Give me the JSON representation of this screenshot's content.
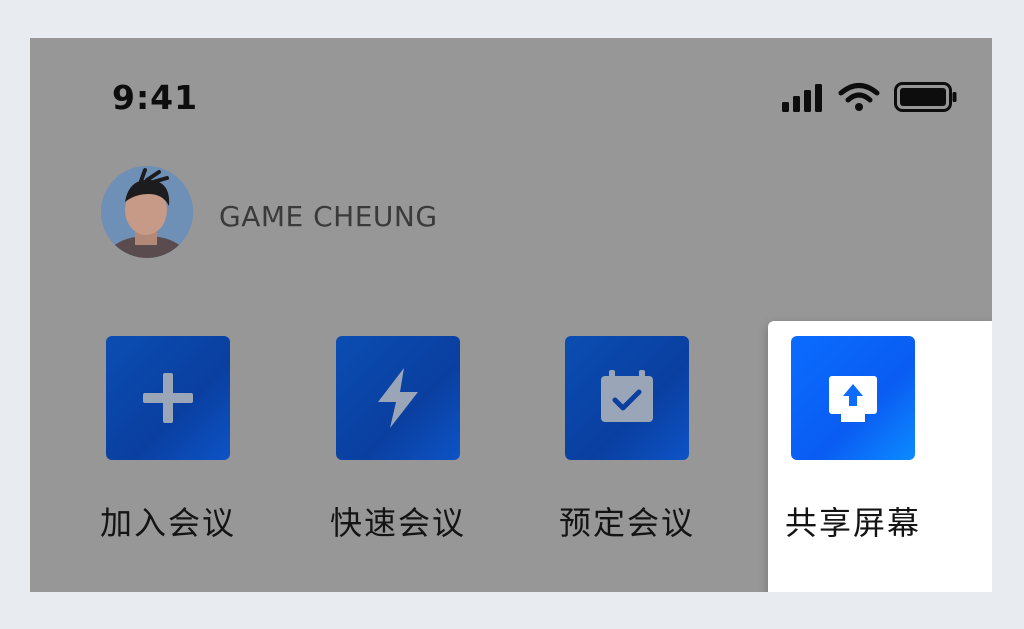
{
  "status_bar": {
    "time": "9:41",
    "icons": [
      "signal-icon",
      "wifi-icon",
      "battery-icon"
    ]
  },
  "user": {
    "name": "GAME CHEUNG",
    "avatar": "avatar-photo"
  },
  "actions": [
    {
      "label": "加入会议",
      "icon": "plus-icon"
    },
    {
      "label": "快速会议",
      "icon": "lightning-icon"
    },
    {
      "label": "预定会议",
      "icon": "calendar-check-icon"
    },
    {
      "label": "共享屏幕",
      "icon": "share-screen-icon",
      "highlighted": true
    }
  ],
  "colors": {
    "overlay": "#979797",
    "tile_dim": "#0b4db2",
    "tile_bright": "#0b6cff",
    "page_bg": "#e8ebf0",
    "card_bg": "#ffffff"
  }
}
